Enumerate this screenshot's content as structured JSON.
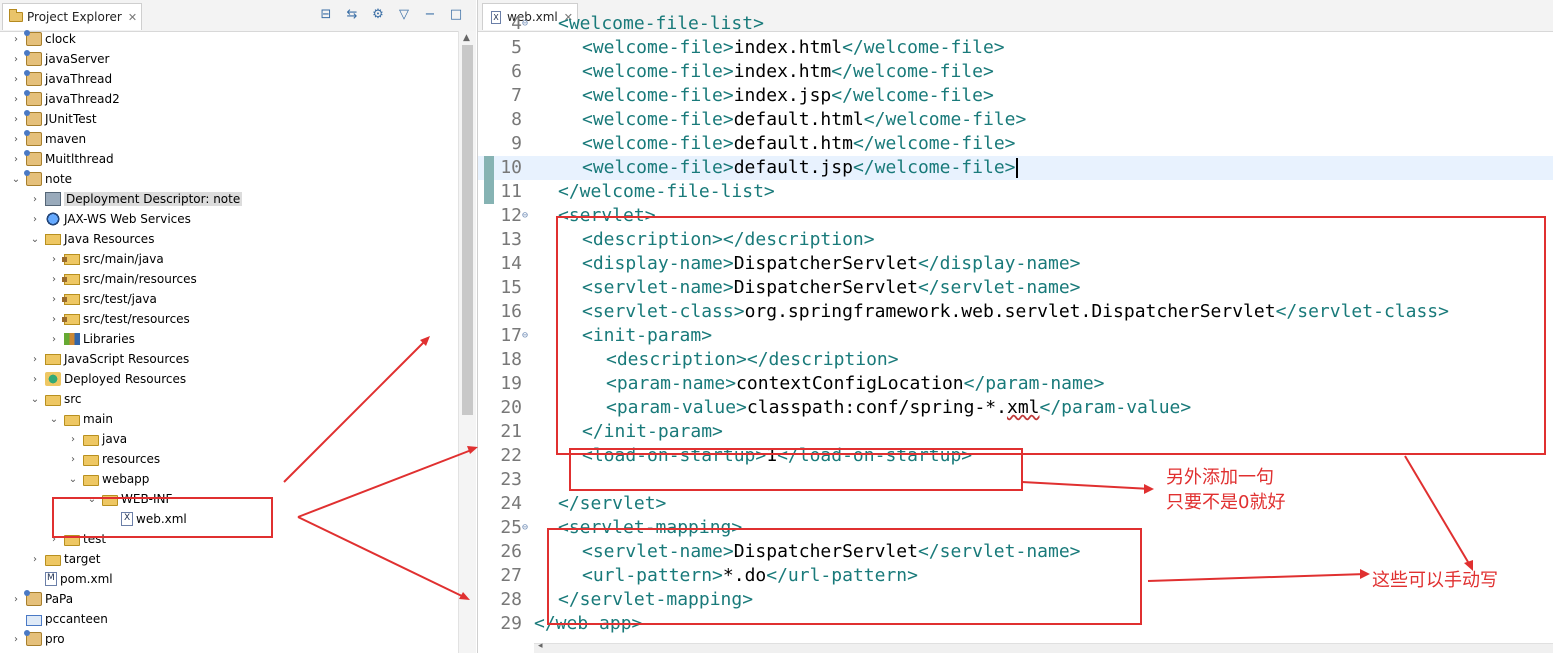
{
  "project_explorer": {
    "tab_label": "Project Explorer",
    "tree": [
      {
        "depth": 0,
        "arrow": "›",
        "icon": "project-icon",
        "label": "clock"
      },
      {
        "depth": 0,
        "arrow": "›",
        "icon": "project-icon",
        "label": "javaServer"
      },
      {
        "depth": 0,
        "arrow": "›",
        "icon": "project-icon",
        "label": "javaThread"
      },
      {
        "depth": 0,
        "arrow": "›",
        "icon": "project-icon",
        "label": "javaThread2"
      },
      {
        "depth": 0,
        "arrow": "›",
        "icon": "project-icon",
        "label": "JUnitTest"
      },
      {
        "depth": 0,
        "arrow": "›",
        "icon": "maven-project-icon",
        "label": "maven"
      },
      {
        "depth": 0,
        "arrow": "›",
        "icon": "project-icon",
        "label": "Muitlthread"
      },
      {
        "depth": 0,
        "arrow": "⌄",
        "icon": "maven-project-icon",
        "label": "note"
      },
      {
        "depth": 1,
        "arrow": "›",
        "icon": "deployment-descriptor-icon",
        "label": "Deployment Descriptor: note",
        "selected": true
      },
      {
        "depth": 1,
        "arrow": "›",
        "icon": "web-services-icon",
        "label": "JAX-WS Web Services"
      },
      {
        "depth": 1,
        "arrow": "⌄",
        "icon": "java-resources-icon",
        "label": "Java Resources"
      },
      {
        "depth": 2,
        "arrow": "›",
        "icon": "source-folder-icon",
        "label": "src/main/java"
      },
      {
        "depth": 2,
        "arrow": "›",
        "icon": "source-folder-icon",
        "label": "src/main/resources"
      },
      {
        "depth": 2,
        "arrow": "›",
        "icon": "source-folder-icon",
        "label": "src/test/java"
      },
      {
        "depth": 2,
        "arrow": "›",
        "icon": "source-folder-icon",
        "label": "src/test/resources"
      },
      {
        "depth": 2,
        "arrow": "›",
        "icon": "libraries-icon",
        "label": "Libraries"
      },
      {
        "depth": 1,
        "arrow": "›",
        "icon": "javascript-resources-icon",
        "label": "JavaScript Resources"
      },
      {
        "depth": 1,
        "arrow": "›",
        "icon": "deployed-resources-icon",
        "label": "Deployed Resources"
      },
      {
        "depth": 1,
        "arrow": "⌄",
        "icon": "folder-icon",
        "label": "src"
      },
      {
        "depth": 2,
        "arrow": "⌄",
        "icon": "folder-icon",
        "label": "main"
      },
      {
        "depth": 3,
        "arrow": "›",
        "icon": "folder-icon",
        "label": "java"
      },
      {
        "depth": 3,
        "arrow": "›",
        "icon": "folder-icon",
        "label": "resources"
      },
      {
        "depth": 3,
        "arrow": "⌄",
        "icon": "folder-icon",
        "label": "webapp"
      },
      {
        "depth": 4,
        "arrow": "⌄",
        "icon": "folder-icon",
        "label": "WEB-INF"
      },
      {
        "depth": 5,
        "arrow": "",
        "icon": "xml-file-icon",
        "label": "web.xml"
      },
      {
        "depth": 2,
        "arrow": "›",
        "icon": "folder-icon",
        "label": "test"
      },
      {
        "depth": 1,
        "arrow": "›",
        "icon": "folder-icon",
        "label": "target"
      },
      {
        "depth": 1,
        "arrow": "",
        "icon": "pom-file-icon",
        "label": "pom.xml"
      },
      {
        "depth": 0,
        "arrow": "›",
        "icon": "project-icon",
        "label": "PaPa"
      },
      {
        "depth": 0,
        "arrow": "",
        "icon": "plain-project-icon",
        "label": "pccanteen"
      },
      {
        "depth": 0,
        "arrow": "›",
        "icon": "project-icon",
        "label": "pro"
      }
    ]
  },
  "editor": {
    "tab_label": "web.xml",
    "current_line": "10",
    "lines": [
      {
        "n": "4",
        "fold": true,
        "segs": [
          [
            "t",
            "<welcome-file-list>"
          ]
        ]
      },
      {
        "n": "5",
        "segs": [
          [
            "t",
            "<welcome-file>"
          ],
          [
            "x",
            "index.html"
          ],
          [
            "t",
            "</welcome-file>"
          ]
        ]
      },
      {
        "n": "6",
        "segs": [
          [
            "t",
            "<welcome-file>"
          ],
          [
            "x",
            "index.htm"
          ],
          [
            "t",
            "</welcome-file>"
          ]
        ]
      },
      {
        "n": "7",
        "segs": [
          [
            "t",
            "<welcome-file>"
          ],
          [
            "x",
            "index.jsp"
          ],
          [
            "t",
            "</welcome-file>"
          ]
        ]
      },
      {
        "n": "8",
        "segs": [
          [
            "t",
            "<welcome-file>"
          ],
          [
            "x",
            "default.html"
          ],
          [
            "t",
            "</welcome-file>"
          ]
        ]
      },
      {
        "n": "9",
        "segs": [
          [
            "t",
            "<welcome-file>"
          ],
          [
            "x",
            "default.htm"
          ],
          [
            "t",
            "</welcome-file>"
          ]
        ]
      },
      {
        "n": "10",
        "segs": [
          [
            "t",
            "<welcome-file>"
          ],
          [
            "x",
            "default.jsp"
          ],
          [
            "t",
            "</welcome-file>"
          ]
        ]
      },
      {
        "n": "11",
        "segs": [
          [
            "t",
            "</welcome-file-list>"
          ]
        ]
      },
      {
        "n": "12",
        "fold": true,
        "segs": [
          [
            "t",
            "<servlet>"
          ]
        ]
      },
      {
        "n": "13",
        "segs": [
          [
            "t",
            "<description></description>"
          ]
        ]
      },
      {
        "n": "14",
        "segs": [
          [
            "t",
            "<display-name>"
          ],
          [
            "x",
            "DispatcherServlet"
          ],
          [
            "t",
            "</display-name>"
          ]
        ]
      },
      {
        "n": "15",
        "segs": [
          [
            "t",
            "<servlet-name>"
          ],
          [
            "x",
            "DispatcherServlet"
          ],
          [
            "t",
            "</servlet-name>"
          ]
        ]
      },
      {
        "n": "16",
        "segs": [
          [
            "t",
            "<servlet-class>"
          ],
          [
            "x",
            "org.springframework.web.servlet.DispatcherServlet"
          ],
          [
            "t",
            "</servlet-class>"
          ]
        ]
      },
      {
        "n": "17",
        "fold": true,
        "segs": [
          [
            "t",
            "<init-param>"
          ]
        ]
      },
      {
        "n": "18",
        "segs": [
          [
            "t",
            "<description></description>"
          ]
        ]
      },
      {
        "n": "19",
        "segs": [
          [
            "t",
            "<param-name>"
          ],
          [
            "x",
            "contextConfigLocation"
          ],
          [
            "t",
            "</param-name>"
          ]
        ]
      },
      {
        "n": "20",
        "segs": [
          [
            "t",
            "<param-value>"
          ],
          [
            "x",
            "classpath:conf/spring-*."
          ],
          [
            "s",
            "xml"
          ],
          [
            "t",
            "</param-value>"
          ]
        ]
      },
      {
        "n": "21",
        "segs": [
          [
            "t",
            "</init-param>"
          ]
        ]
      },
      {
        "n": "22",
        "segs": [
          [
            "t",
            "<load-on-startup>"
          ],
          [
            "x",
            "1"
          ],
          [
            "t",
            "</load-on-startup>"
          ]
        ]
      },
      {
        "n": "23",
        "segs": []
      },
      {
        "n": "24",
        "segs": [
          [
            "t",
            "</servlet>"
          ]
        ]
      },
      {
        "n": "25",
        "fold": true,
        "segs": [
          [
            "t",
            "<servlet-mapping>"
          ]
        ]
      },
      {
        "n": "26",
        "segs": [
          [
            "t",
            "<servlet-name>"
          ],
          [
            "x",
            "DispatcherServlet"
          ],
          [
            "t",
            "</servlet-name>"
          ]
        ]
      },
      {
        "n": "27",
        "segs": [
          [
            "t",
            "<url-pattern>"
          ],
          [
            "x",
            "*.do"
          ],
          [
            "t",
            "</url-pattern>"
          ]
        ]
      },
      {
        "n": "28",
        "segs": [
          [
            "t",
            "</servlet-mapping>"
          ]
        ]
      },
      {
        "n": "29",
        "segs": [
          [
            "t",
            "</web-app>"
          ]
        ]
      }
    ]
  },
  "annotations": {
    "note_load_on_startup_line1": "另外添加一句",
    "note_load_on_startup_line2": "只要不是0就好",
    "note_manual": "这些可以手动写",
    "color": "#e03030"
  }
}
